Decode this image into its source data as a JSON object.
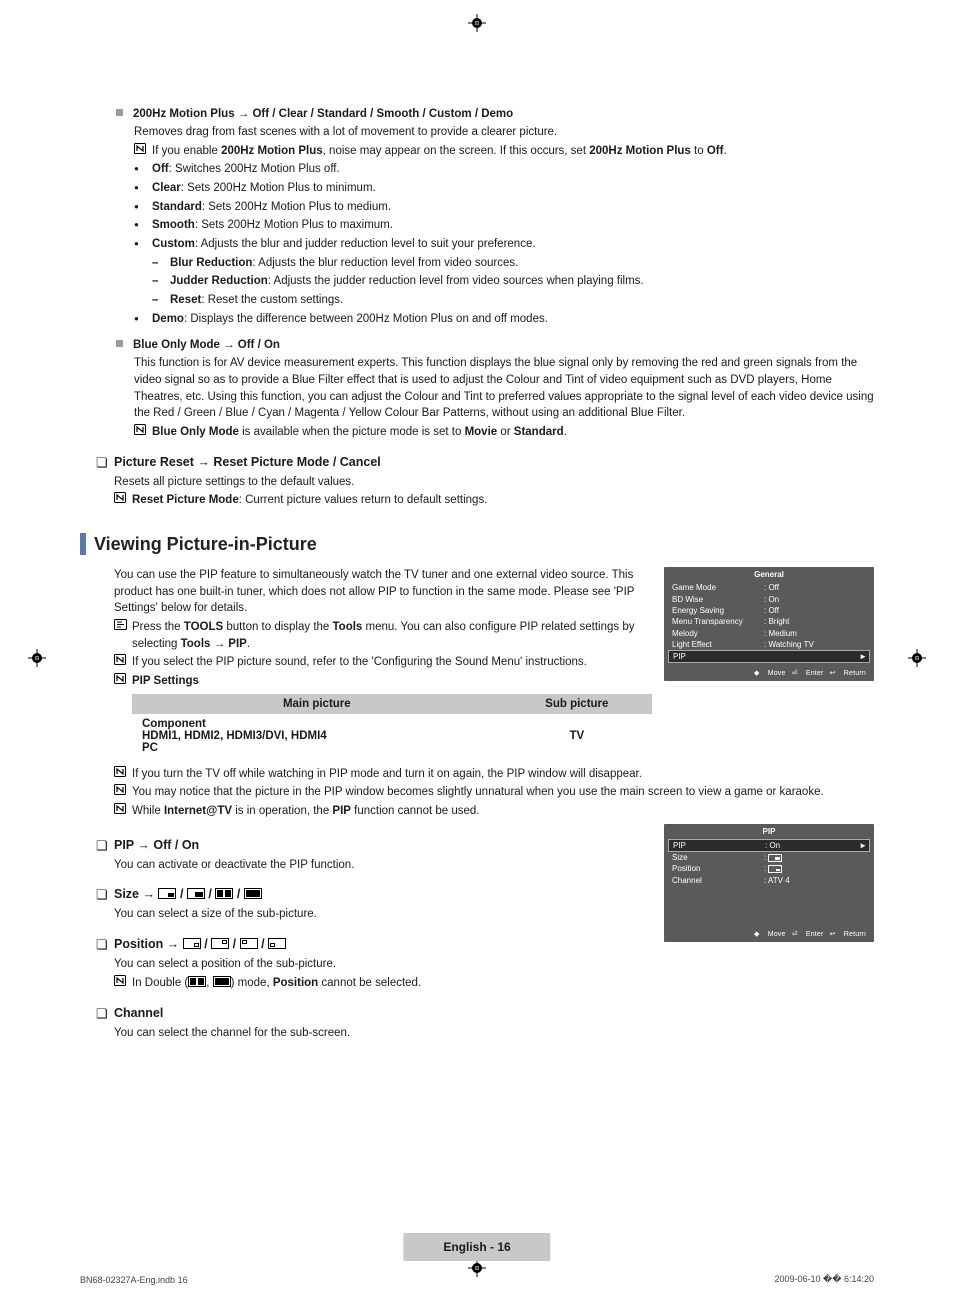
{
  "motion": {
    "title_a": "200Hz Motion Plus → Off / Clear / Standard / Smooth / Custom / Demo",
    "desc": "Removes drag from fast scenes with a lot of movement to provide a clearer picture.",
    "note1_a": "If you enable ",
    "note1_b": "200Hz Motion Plus",
    "note1_c": ", noise may appear on the screen. If this occurs, set ",
    "note1_d": "200Hz Motion Plus",
    "note1_e": " to ",
    "note1_f": "Off",
    "note1_g": ".",
    "off_k": "Off",
    "off_v": ": Switches 200Hz Motion Plus off.",
    "clear_k": "Clear",
    "clear_v": ": Sets 200Hz Motion Plus to minimum.",
    "std_k": "Standard",
    "std_v": ": Sets 200Hz Motion Plus to medium.",
    "smooth_k": "Smooth",
    "smooth_v": ": Sets 200Hz Motion Plus to maximum.",
    "custom_k": "Custom",
    "custom_v": ": Adjusts the blur and judder reduction level to suit your preference.",
    "blur_k": "Blur Reduction",
    "blur_v": ": Adjusts the blur reduction level from video sources.",
    "jud_k": "Judder Reduction",
    "jud_v": ": Adjusts the judder reduction level from video sources when playing films.",
    "reset_k": "Reset",
    "reset_v": ": Reset the custom settings.",
    "demo_k": "Demo",
    "demo_v": ": Displays the difference between 200Hz Motion Plus on and off modes."
  },
  "blue": {
    "title": "Blue Only Mode → Off / On",
    "desc": "This function is for AV device measurement experts. This function displays the blue signal only by removing the red and green signals from the video signal so as to provide a Blue Filter effect that is used to adjust the Colour and Tint of video equipment such as DVD players, Home Theatres, etc. Using this function, you can adjust the Colour and Tint to preferred values appropriate to the signal level of each video device using the Red / Green / Blue / Cyan / Magenta / Yellow Colour Bar Patterns, without using an additional Blue Filter.",
    "note_a": "Blue Only Mode",
    "note_b": " is available when the picture mode is set to ",
    "note_c": "Movie",
    "note_d": " or ",
    "note_e": "Standard",
    "note_f": "."
  },
  "preset": {
    "title": "Picture Reset → Reset Picture Mode / Cancel",
    "desc": "Resets all picture settings to the default values.",
    "note_a": "Reset Picture Mode",
    "note_b": ": Current picture values return to default settings."
  },
  "pip_section": {
    "title": "Viewing Picture-in-Picture",
    "p1": "You can use the PIP feature to simultaneously watch the TV tuner and one external video source. This product has one built-in tuner, which does not allow PIP to function in the same mode. Please see 'PIP Settings' below for details.",
    "tool_a": "Press the ",
    "tool_b": "TOOLS",
    "tool_c": " button to display the ",
    "tool_d": "Tools",
    "tool_e": " menu. You can also configure PIP related settings by selecting ",
    "tool_f": "Tools → PIP",
    "tool_g": ".",
    "n2": "If you select the PIP picture sound, refer to the 'Configuring the Sound Menu' instructions.",
    "settings": "PIP Settings",
    "th1": "Main picture",
    "th2": "Sub picture",
    "td1a": "Component",
    "td1b": "HDMI1",
    "td1c": "HDMI2",
    "td1d": "HDMI3/DVI",
    "td1e": "HDMI4",
    "td1f": "PC",
    "td2": "TV",
    "n3": "If you turn the TV off while watching in PIP mode and turn it on again, the PIP window will disappear.",
    "n4": "You may notice that the picture in the PIP window becomes slightly unnatural when you use the main screen to view a game or karaoke.",
    "n5_a": "While ",
    "n5_b": "Internet@TV",
    "n5_c": " is in operation, the ",
    "n5_d": "PIP",
    "n5_e": " function cannot be used."
  },
  "pip_onoff": {
    "title": "PIP → Off / On",
    "desc": "You can activate or deactivate the PIP function."
  },
  "size": {
    "title": "Size → ",
    "slash": " / ",
    "desc": "You can select a size of the sub-picture."
  },
  "position": {
    "title": "Position → ",
    "slash": " / ",
    "desc": "You can select a position of the sub-picture.",
    "note_a": "In Double (",
    "note_b": ") mode, ",
    "note_c": "Position",
    "note_d": " cannot be selected.",
    "note_comma": ", "
  },
  "channel": {
    "title": "Channel",
    "desc": "You can select the channel for the sub-screen."
  },
  "osd1": {
    "title": "General",
    "rows": [
      {
        "k": "Game Mode",
        "v": ": Off"
      },
      {
        "k": "BD Wise",
        "v": ": On"
      },
      {
        "k": "Energy Saving",
        "v": ": Off"
      },
      {
        "k": "Menu Transparency",
        "v": ": Bright"
      },
      {
        "k": "Melody",
        "v": ": Medium"
      },
      {
        "k": "Light Effect",
        "v": ": Watching TV"
      }
    ],
    "hl": {
      "k": "PIP",
      "arrow": "►"
    },
    "foot": {
      "move": "Move",
      "enter": "Enter",
      "return": "Return"
    }
  },
  "osd2": {
    "title": "PIP",
    "hl": {
      "k": "PIP",
      "v": ": On",
      "arrow": "►"
    },
    "rows": [
      {
        "k": "Size",
        "v": ":"
      },
      {
        "k": "Position",
        "v": ":"
      },
      {
        "k": "Channel",
        "v": ": ATV 4"
      }
    ],
    "foot": {
      "move": "Move",
      "enter": "Enter",
      "return": "Return"
    }
  },
  "footer": {
    "badge": "English - 16",
    "left": "BN68-02327A-Eng.indb   16",
    "right": "2009-06-10   �� 6:14:20"
  },
  "glyph": {
    "updown": "◆",
    "enter": "⏎",
    "return": "↩"
  }
}
